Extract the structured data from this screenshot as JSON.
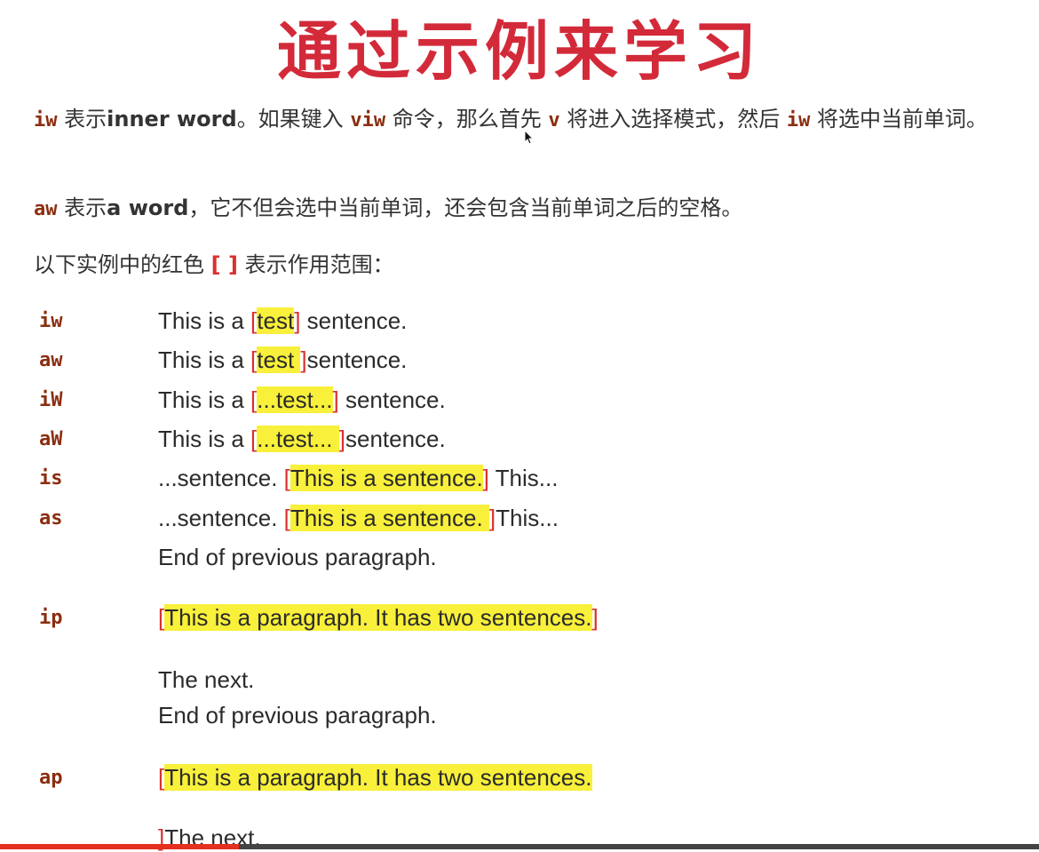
{
  "title": "通过示例来学习",
  "intro": {
    "p1": {
      "code1": "iw",
      "t1": " 表示",
      "strong1": "inner word",
      "t2": "。如果键入 ",
      "code2": "viw",
      "t3": " 命令，那么首先 ",
      "code3": "v",
      "t4": " 将进入选择模式，然后 ",
      "code4": "iw",
      "t5": " 将选中当前单词。"
    },
    "p2": {
      "code1": "aw",
      "t1": " 表示",
      "strong1": "a word",
      "t2": "，它不但会选中当前单词，还会包含当前单词之后的空格。"
    },
    "p3": {
      "t1": "以下实例中的红色 ",
      "bracket": "[ ]",
      "t2": " 表示作用范围："
    }
  },
  "examples": [
    {
      "cmd": "iw",
      "pre": "This is a ",
      "ob": "[",
      "hl": "test",
      "cb": "]",
      "post": " sentence."
    },
    {
      "cmd": "aw",
      "pre": "This is a ",
      "ob": "[",
      "hl": "test ",
      "cb": "]",
      "post": "sentence."
    },
    {
      "cmd": "iW",
      "pre": "This is a ",
      "ob": "[",
      "hl": "...test...",
      "cb": "]",
      "post": " sentence."
    },
    {
      "cmd": "aW",
      "pre": "This is a ",
      "ob": "[",
      "hl": "...test... ",
      "cb": "]",
      "post": "sentence."
    },
    {
      "cmd": "is",
      "pre": "...sentence. ",
      "ob": "[",
      "hl": "This is a sentence.",
      "cb": "]",
      "post": " This..."
    },
    {
      "cmd": "as",
      "pre": "...sentence. ",
      "ob": "[",
      "hl": "This is a sentence. ",
      "cb": "]",
      "post": "This..."
    }
  ],
  "paragraph_examples": {
    "prev1": "End of previous paragraph.",
    "ip": {
      "cmd": "ip",
      "ob": "[",
      "hl": "This is a paragraph. It has two sentences.",
      "cb": "]"
    },
    "next1": "The next.",
    "prev2": "End of previous paragraph.",
    "ap": {
      "cmd": "ap",
      "ob": "[",
      "hl": "This is a paragraph. It has two sentences."
    },
    "ap_cb": "]",
    "next2": "The next."
  },
  "video_progress": 0.23
}
